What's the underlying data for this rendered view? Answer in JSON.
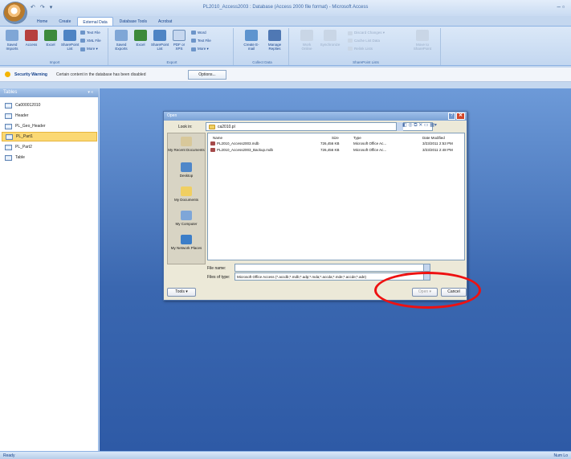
{
  "window": {
    "title": "PL2010_Access2003 : Database (Access 2000 file format) - Microsoft Access",
    "quick_access": [
      "↶",
      "↷",
      "▾"
    ],
    "controls": "–  ▫"
  },
  "tabs": [
    {
      "label": "Home",
      "active": false
    },
    {
      "label": "Create",
      "active": false
    },
    {
      "label": "External Data",
      "active": true
    },
    {
      "label": "Database Tools",
      "active": false
    },
    {
      "label": "Acrobat",
      "active": false
    }
  ],
  "ribbon": {
    "import": {
      "label": "Import",
      "saved_imports": "Saved Imports",
      "access": "Access",
      "excel": "Excel",
      "sharepoint_list": "SharePoint List",
      "text_file": "Text File",
      "xml_file": "XML File",
      "more": "More ▾"
    },
    "export": {
      "label": "Export",
      "saved_exports": "Saved Exports",
      "excel": "Excel",
      "sharepoint_list": "SharePoint List",
      "pdf_xps": "PDF or XPS",
      "word": "Word",
      "text_file": "Text File",
      "more": "More ▾"
    },
    "collect": {
      "label": "Collect Data",
      "create_email": "Create E-mail",
      "manage_replies": "Manage Replies"
    },
    "sharepoint": {
      "label": "SharePoint Lists",
      "work_online": "Work Online",
      "synchronize": "Synchronize",
      "discard_changes": "Discard Changes ▾",
      "cache_list_data": "Cache List Data",
      "relink_lists": "Relink Lists",
      "move_to_sharepoint": "Move to SharePoint"
    }
  },
  "security_bar": {
    "title": "Security Warning",
    "message": "Certain content in the database has been disabled",
    "options_label": "Options..."
  },
  "nav_pane": {
    "header": "Tables",
    "header_controls": "▾ «",
    "items": [
      {
        "label": "Ca000012010",
        "selected": false
      },
      {
        "label": "Header",
        "selected": false
      },
      {
        "label": "PL_Geo_Header",
        "selected": false
      },
      {
        "label": "PL_Part1",
        "selected": true
      },
      {
        "label": "PL_Part2",
        "selected": false
      },
      {
        "label": "Table",
        "selected": false
      }
    ]
  },
  "status_bar": {
    "left": "Ready",
    "right": "Num Lo"
  },
  "dialog": {
    "title": "Open",
    "help": "?",
    "close": "✕",
    "look_in_label": "Look in:",
    "look_in_value": "ca2010.pl",
    "toolbar_icons": "◧ ◎ ⧉ ✕ ▭ ▦▾",
    "places": [
      {
        "label": "My Recent Documents",
        "icon": "recent-icon",
        "color": "#d8c89a"
      },
      {
        "label": "Desktop",
        "icon": "desktop-icon",
        "color": "#4f87c9"
      },
      {
        "label": "My Documents",
        "icon": "my-documents-icon",
        "color": "#f0cf62"
      },
      {
        "label": "My Computer",
        "icon": "my-computer-icon",
        "color": "#7ea6d8"
      },
      {
        "label": "My Network Places",
        "icon": "network-icon",
        "color": "#3c7ec8"
      }
    ],
    "columns": {
      "name": "Name",
      "size": "Size",
      "type": "Type",
      "date": "Date Modified"
    },
    "files": [
      {
        "name": "PL2010_Access2003.mdb",
        "size": "726,456 KB",
        "type": "Microsoft Office Ac...",
        "date": "3/23/2011 2:53 PM"
      },
      {
        "name": "PL2010_Access2003_Backup.mdb",
        "size": "726,456 KB",
        "type": "Microsoft Office Ac...",
        "date": "3/23/2011 2:48 PM"
      }
    ],
    "file_name_label": "File name:",
    "file_name_value": "",
    "file_type_label": "Files of type:",
    "file_type_value": "Microsoft Office Access (*.accdb;*.mdb;*.adp;*.mda;*.accda;*.mde;*.accde;*.ade)",
    "tools_label": "Tools ▾",
    "open_label": "Open ▾",
    "cancel_label": "Cancel"
  },
  "colors": {
    "accent": "#15428b",
    "selection": "#fbd873",
    "annotation": "#ee1111"
  }
}
